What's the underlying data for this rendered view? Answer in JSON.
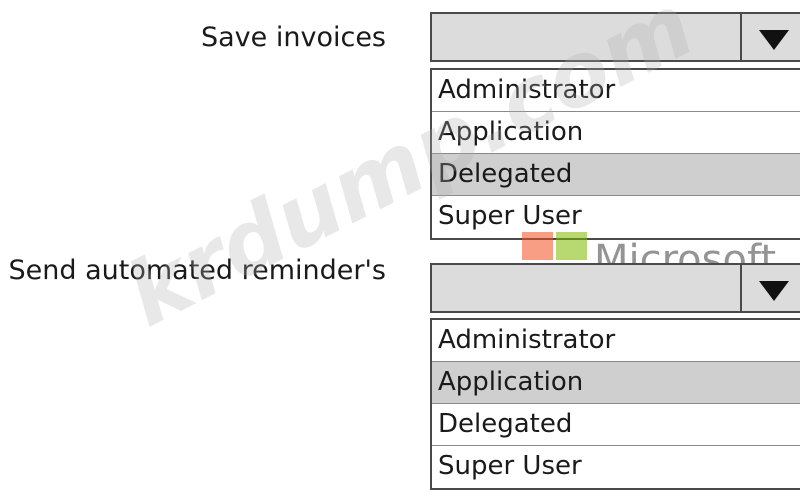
{
  "rows": [
    {
      "label": "Save invoices",
      "options": [
        "Administrator",
        "Application",
        "Delegated",
        "Super User"
      ],
      "selected_index": 2
    },
    {
      "label": "Send automated reminder's",
      "options": [
        "Administrator",
        "Application",
        "Delegated",
        "Super User"
      ],
      "selected_index": 1
    }
  ],
  "watermark": {
    "text": "krdump.com",
    "logo_text": "Microsoft",
    "logo_colors": [
      "#f25022",
      "#7fba00",
      "#00a4ef",
      "#ffb900"
    ]
  },
  "icons": {
    "dropdown": "caret-down-icon"
  }
}
